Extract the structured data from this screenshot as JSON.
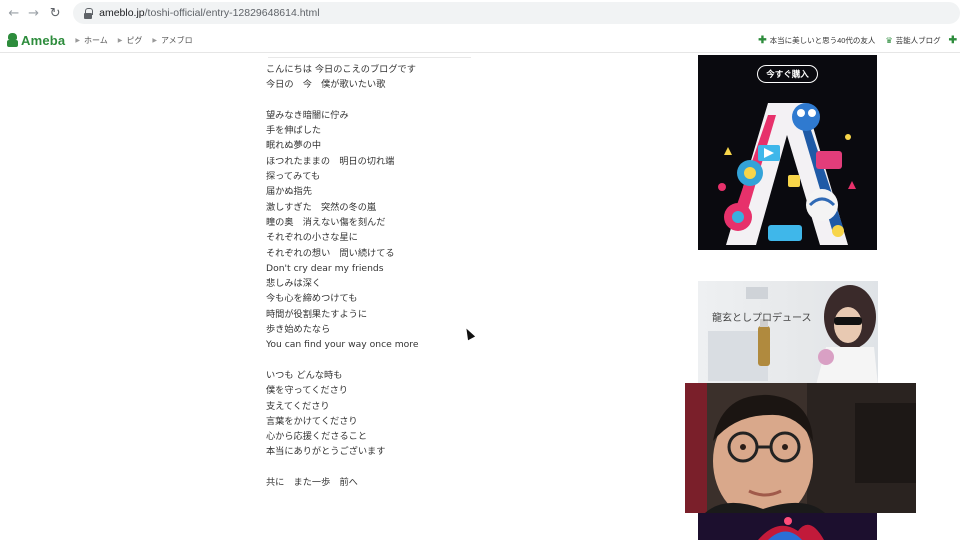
{
  "browser": {
    "url_host": "ameblo.jp",
    "url_path": "/toshi-official/entry-12829648614.html"
  },
  "header": {
    "logo_text": "Ameba",
    "breadcrumbs": [
      "ホーム",
      "ピグ",
      "アメブロ"
    ],
    "right_links": [
      {
        "label": "本当に美しいと思う40代の友人",
        "icon": "plus-icon"
      },
      {
        "label": "芸能人ブログ",
        "icon": "crown-icon"
      }
    ],
    "accent": "#2d8c3c"
  },
  "article": {
    "lines": [
      "こんにちは 今日のこえのブログです",
      "今日の　今　僕が歌いたい歌",
      "",
      "望みなき暗闇に佇み",
      "手を伸ばした",
      "眠れぬ夢の中",
      "ほつれたままの　明日の切れ端",
      "探ってみても",
      "届かぬ指先",
      "激しすぎた　突然の冬の嵐",
      "瞳の奥　消えない傷を刻んだ",
      "それぞれの小さな星に",
      "それぞれの想い　問い続けてる",
      "Don't cry dear my friends",
      "悲しみは深く",
      "今も心を締めつけても",
      "時間が役割果たすように",
      "歩き始めたなら",
      "You can find your way once more",
      "",
      "いつも どんな時も",
      "僕を守ってくださり",
      "支えてくださり",
      "言葉をかけてくださり",
      "心から応援くださること",
      "本当にありがとうございます",
      "",
      "共に　また一歩　前へ"
    ]
  },
  "ads": {
    "ad1_button": "今すぐ購入",
    "ad2_title": "龍玄としプロデュース"
  }
}
